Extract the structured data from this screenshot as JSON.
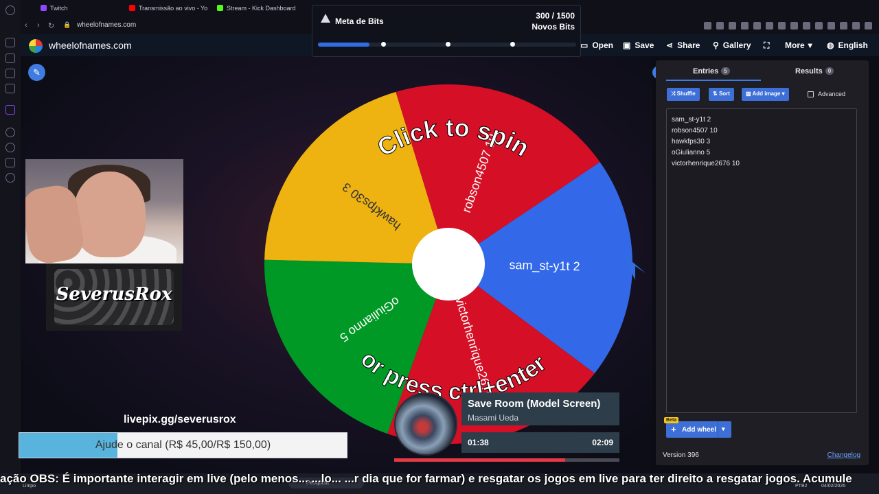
{
  "browser": {
    "tabs": [
      {
        "label": "Twitch",
        "color": "#9146ff"
      },
      {
        "label": "Transmissão ao vivo - Yo",
        "color": "#ff0000"
      },
      {
        "label": "Stream - Kick Dashboard",
        "color": "#53fc18"
      }
    ],
    "url": "wheelofnames.com"
  },
  "header": {
    "site_name": "wheelofnames.com",
    "buttons": {
      "open": "Open",
      "save": "Save",
      "share": "Share",
      "gallery": "Gallery",
      "more": "More",
      "language": "English"
    }
  },
  "bits": {
    "title": "Meta de Bits",
    "count": "300 / 1500",
    "subtitle": "Novos Bits",
    "progress_fraction": 0.2
  },
  "wheel": {
    "segments": [
      {
        "label": "sam_st-y1t 2",
        "color": "#3369e8"
      },
      {
        "label": "robson4507 10",
        "color": "#d50f25"
      },
      {
        "label": "hawkfps30 3",
        "color": "#eeb211"
      },
      {
        "label": "oGiulianno 5",
        "color": "#009925"
      },
      {
        "label": "victorhenrique2676 10",
        "color": "#d50f25"
      }
    ],
    "center_color": "#ffffff",
    "pointer_color": "#2f6de0",
    "prompt_top": "Click to spin",
    "prompt_bottom": "or press ctrl+enter"
  },
  "panel": {
    "tab_entries": "Entries",
    "entries_count": "5",
    "tab_results": "Results",
    "results_count": "0",
    "toolbar": {
      "shuffle": "Shuffle",
      "sort": "Sort",
      "add_image": "Add image",
      "advanced": "Advanced"
    },
    "entries": [
      "sam_st-y1t 2",
      "robson4507 10",
      "hawkfps30 3",
      "oGiulianno 5",
      "victorhenrique2676 10"
    ],
    "beta": "Beta",
    "add_wheel": "Add wheel",
    "version": "Version 396",
    "changelog": "Changelog"
  },
  "stream": {
    "logo_text": "SeverusRox",
    "livepix": "livepix.gg/severusrox",
    "donation_text": "Ajude o canal (R$ 45,00/R$ 150,00)",
    "donation_fraction": 0.3,
    "song": {
      "title": "Save Room (Model Screen)",
      "artist": "Masami Ueda",
      "elapsed": "01:38",
      "total": "02:09",
      "progress_fraction": 0.76
    },
    "ticker": "ação OBS: É importante interagir em live  (pelo menos... ...lo... ...r dia que for farmar) e resgatar os jogos em live para ter direito a resgatar jogos. Acumule"
  },
  "taskbar": {
    "weather": "Limpo",
    "search_placeholder": "Pesquisa",
    "lang": "PTB2",
    "date": "04/02/2026"
  }
}
